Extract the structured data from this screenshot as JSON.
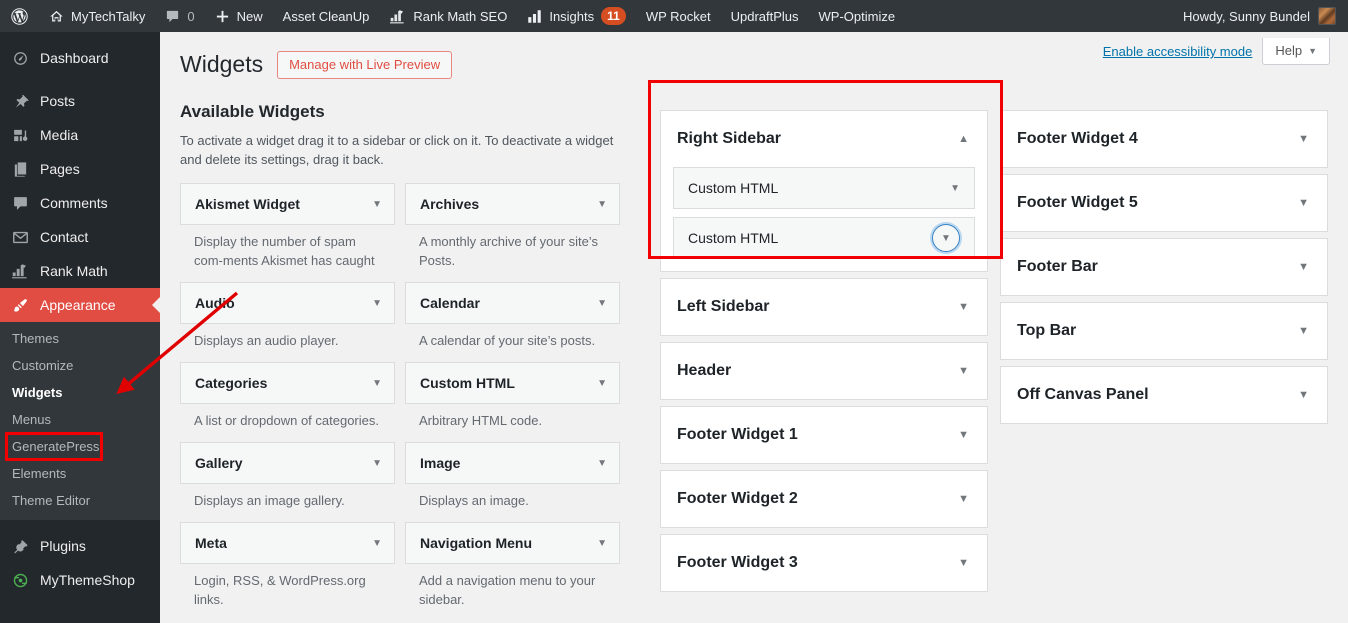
{
  "adminbar": {
    "items": [
      {
        "icon": "wordpress-logo-icon",
        "label": ""
      },
      {
        "icon": "home-icon",
        "label": "MyTechTalky"
      },
      {
        "icon": "comment-bubble-icon",
        "label": "",
        "count": "0"
      },
      {
        "icon": "plus-icon",
        "label": "New"
      },
      {
        "icon": "",
        "label": "Asset CleanUp"
      },
      {
        "icon": "rank-math-icon",
        "label": "Rank Math SEO"
      },
      {
        "icon": "bar-chart-icon",
        "label": "Insights",
        "badge": "11"
      },
      {
        "icon": "",
        "label": "WP Rocket"
      },
      {
        "icon": "",
        "label": "UpdraftPlus"
      },
      {
        "icon": "",
        "label": "WP-Optimize"
      }
    ],
    "howdy": "Howdy, Sunny Bundel"
  },
  "sidebar": {
    "items": [
      {
        "label": "Dashboard",
        "icon": "dashboard-icon"
      },
      {
        "label": "Posts",
        "icon": "pin-icon"
      },
      {
        "label": "Media",
        "icon": "media-icon"
      },
      {
        "label": "Pages",
        "icon": "pages-icon"
      },
      {
        "label": "Comments",
        "icon": "comments-icon"
      },
      {
        "label": "Contact",
        "icon": "envelope-icon"
      },
      {
        "label": "Rank Math",
        "icon": "rank-math-icon"
      },
      {
        "label": "Appearance",
        "icon": "paintbrush-icon",
        "current": true
      },
      {
        "label": "Plugins",
        "icon": "plug-icon"
      },
      {
        "label": "MyThemeShop",
        "icon": "mythemeshop-icon"
      }
    ],
    "submenu": [
      {
        "label": "Themes"
      },
      {
        "label": "Customize"
      },
      {
        "label": "Widgets",
        "current": true
      },
      {
        "label": "Menus"
      },
      {
        "label": "GeneratePress"
      },
      {
        "label": "Elements"
      },
      {
        "label": "Theme Editor"
      }
    ]
  },
  "screen_meta": {
    "accessibility_link": "Enable accessibility mode",
    "help_label": "Help",
    "help_caret": "▼"
  },
  "header": {
    "page_title": "Widgets",
    "live_preview_button": "Manage with Live Preview"
  },
  "available": {
    "heading": "Available Widgets",
    "description": "To activate a widget drag it to a sidebar or click on it. To deactivate a widget and delete its settings, drag it back.",
    "caret": "▼",
    "widgets": [
      {
        "name": "Akismet Widget",
        "desc": "Display the number of spam com-ments Akismet has caught"
      },
      {
        "name": "Archives",
        "desc": "A monthly archive of your site’s Posts."
      },
      {
        "name": "Audio",
        "desc": "Displays an audio player."
      },
      {
        "name": "Calendar",
        "desc": "A calendar of your site’s posts."
      },
      {
        "name": "Categories",
        "desc": "A list or dropdown of categories."
      },
      {
        "name": "Custom HTML",
        "desc": "Arbitrary HTML code."
      },
      {
        "name": "Gallery",
        "desc": "Displays an image gallery."
      },
      {
        "name": "Image",
        "desc": "Displays an image."
      },
      {
        "name": "Meta",
        "desc": "Login, RSS, & WordPress.org links."
      },
      {
        "name": "Navigation Menu",
        "desc": "Add a navigation menu to your sidebar."
      }
    ]
  },
  "sidebars": {
    "caret_down": "▼",
    "caret_up": "▲",
    "middle_column": [
      {
        "title": "Right Sidebar",
        "expanded": true,
        "widgets": [
          {
            "name": "Custom HTML",
            "focused": false
          },
          {
            "name": "Custom HTML",
            "focused": true
          }
        ]
      },
      {
        "title": "Left Sidebar",
        "expanded": false,
        "widgets": []
      },
      {
        "title": "Header",
        "expanded": false,
        "widgets": []
      },
      {
        "title": "Footer Widget 1",
        "expanded": false,
        "widgets": []
      },
      {
        "title": "Footer Widget 2",
        "expanded": false,
        "widgets": []
      },
      {
        "title": "Footer Widget 3",
        "expanded": false,
        "widgets": []
      }
    ],
    "right_column": [
      {
        "title": "Footer Widget 4",
        "expanded": false,
        "widgets": []
      },
      {
        "title": "Footer Widget 5",
        "expanded": false,
        "widgets": []
      },
      {
        "title": "Footer Bar",
        "expanded": false,
        "widgets": []
      },
      {
        "title": "Top Bar",
        "expanded": false,
        "widgets": []
      },
      {
        "title": "Off Canvas Panel",
        "expanded": false,
        "widgets": []
      }
    ]
  },
  "annotations": {
    "highlight_color": "#f20000",
    "arrow_color": "#e00000",
    "highlighted_elements": [
      "sidebar-item-widgets",
      "right-sidebar-panel"
    ]
  },
  "colors": {
    "adminbar_bg": "#32373c",
    "adminmenu_bg": "#23282d",
    "submenu_bg": "#32373c",
    "current_menu": "#e14d43",
    "badge": "#d54e21",
    "link": "#0073aa",
    "content_bg": "#f1f1f1"
  }
}
